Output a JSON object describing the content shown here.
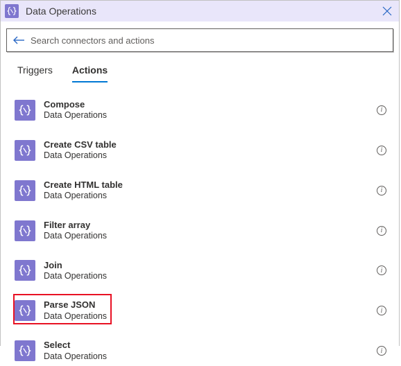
{
  "header": {
    "title": "Data Operations"
  },
  "search": {
    "placeholder": "Search connectors and actions",
    "value": ""
  },
  "tabs": {
    "triggers": "Triggers",
    "actions": "Actions",
    "active": "actions"
  },
  "actions": [
    {
      "title": "Compose",
      "subtitle": "Data Operations",
      "highlighted": false
    },
    {
      "title": "Create CSV table",
      "subtitle": "Data Operations",
      "highlighted": false
    },
    {
      "title": "Create HTML table",
      "subtitle": "Data Operations",
      "highlighted": false
    },
    {
      "title": "Filter array",
      "subtitle": "Data Operations",
      "highlighted": false
    },
    {
      "title": "Join",
      "subtitle": "Data Operations",
      "highlighted": false
    },
    {
      "title": "Parse JSON",
      "subtitle": "Data Operations",
      "highlighted": true
    },
    {
      "title": "Select",
      "subtitle": "Data Operations",
      "highlighted": false
    }
  ],
  "icons": {
    "connector": "braces-icon"
  }
}
